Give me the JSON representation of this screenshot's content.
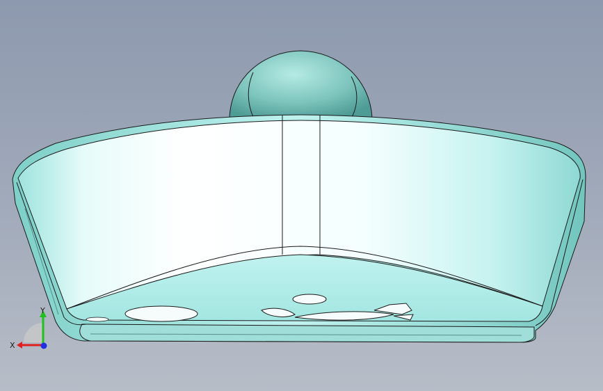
{
  "viewport": {
    "background_top": "#8d99ae",
    "background_bottom": "#b7bdc7"
  },
  "model": {
    "part": "bowl-shaped-shell",
    "shell_color": "#c9f7f4",
    "knob_color": "#6bb7b0",
    "edge_color": "#1a1a1a"
  },
  "triad": {
    "x_label": "X",
    "y_label": "Y",
    "x_color": "#e02020",
    "y_color": "#20c020",
    "z_color": "#2030e0"
  }
}
